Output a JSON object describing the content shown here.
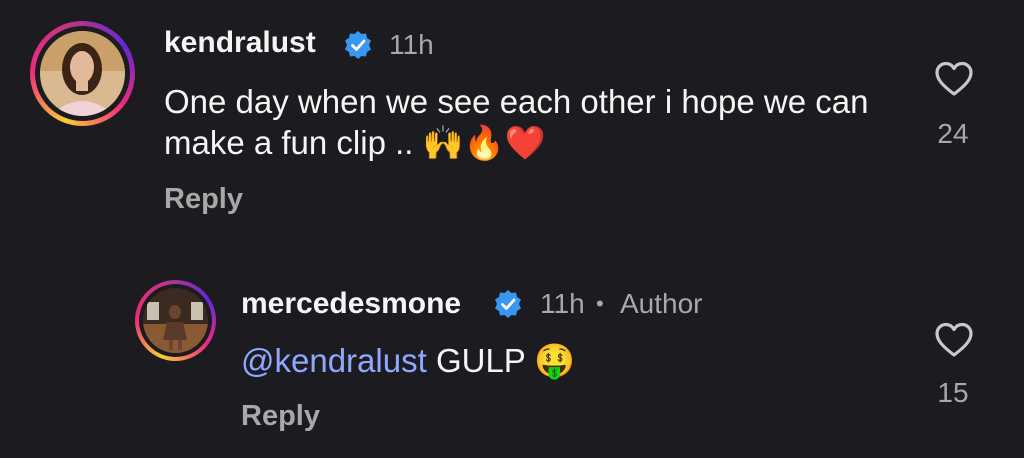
{
  "comments": [
    {
      "username": "kendralust",
      "time": "11h",
      "text": "One day when we see each other i hope we can make a fun clip ..",
      "emojis": "🙌🔥❤️",
      "likes": "24",
      "reply_label": "Reply"
    },
    {
      "username": "mercedesmone",
      "time": "11h",
      "separator": "•",
      "author_tag": "Author",
      "mention": "@kendralust",
      "text": "GULP",
      "emojis": "🤑",
      "likes": "15",
      "reply_label": "Reply"
    }
  ]
}
